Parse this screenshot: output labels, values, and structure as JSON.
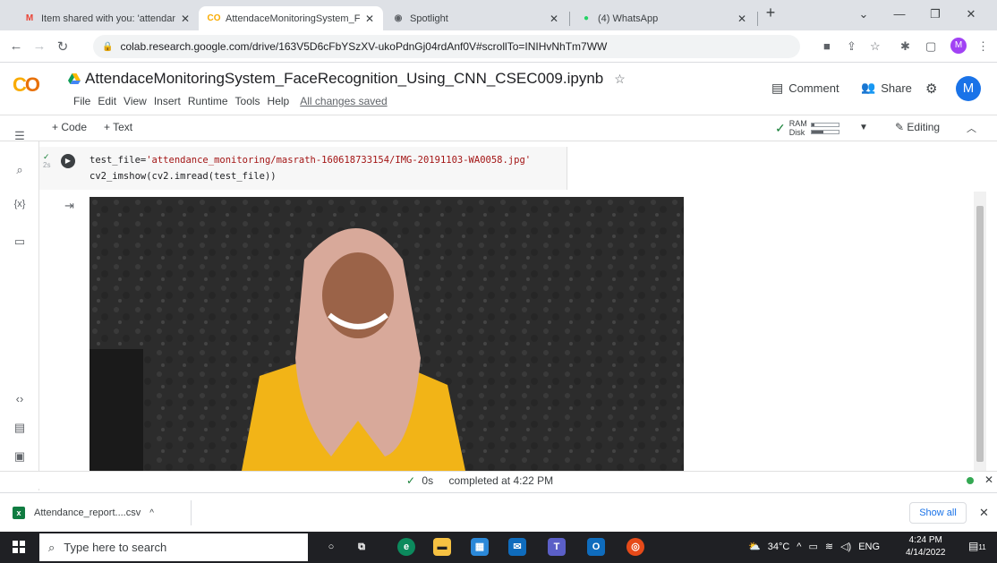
{
  "browser": {
    "tabs": [
      {
        "label": "Item shared with you: 'attendanc",
        "icon": "gmail-icon",
        "active": false
      },
      {
        "label": "AttendaceMonitoringSystem_Fac",
        "icon": "colab-icon",
        "active": true
      },
      {
        "label": "Spotlight",
        "icon": "globe-icon",
        "active": false
      },
      {
        "label": "(4) WhatsApp",
        "icon": "whatsapp-icon",
        "active": false
      }
    ],
    "url": "colab.research.google.com/drive/163V5D6cFbYSzXV-ukoPdnGj04rdAnf0V#scrollTo=INIHvNhTm7WW",
    "profile_initial": "M"
  },
  "colab": {
    "notebook_title": "AttendaceMonitoringSystem_FaceRecognition_Using_CNN_CSEC009.ipynb",
    "menu": [
      "File",
      "Edit",
      "View",
      "Insert",
      "Runtime",
      "Tools",
      "Help"
    ],
    "save_status": "All changes saved",
    "comment_label": "Comment",
    "share_label": "Share",
    "avatar_initial": "M",
    "add_code_label": "+ Code",
    "add_text_label": "+ Text",
    "ram_label": "RAM",
    "disk_label": "Disk",
    "ram_usage": 0.12,
    "disk_usage": 0.45,
    "editing_label": "Editing"
  },
  "cell": {
    "exec_time": "2s",
    "code_line1_prefix": "test_file=",
    "code_line1_string": "'attendance_monitoring/masrath-160618733154/IMG-20191103-WA0058.jpg'",
    "code_line2": "cv2_imshow(cv2.imread(test_file))"
  },
  "status": {
    "duration": "0s",
    "text": "completed at 4:22 PM"
  },
  "downloads": {
    "file_name": "Attendance_report....csv",
    "show_all_label": "Show all"
  },
  "taskbar": {
    "search_placeholder": "Type here to search",
    "weather": "34°C",
    "language": "ENG",
    "time": "4:24 PM",
    "date": "4/14/2022",
    "notification_count": "11"
  },
  "colors": {
    "colab_orange": "#f9ab00",
    "accent_blue": "#1a73e8",
    "success_green": "#188038"
  }
}
